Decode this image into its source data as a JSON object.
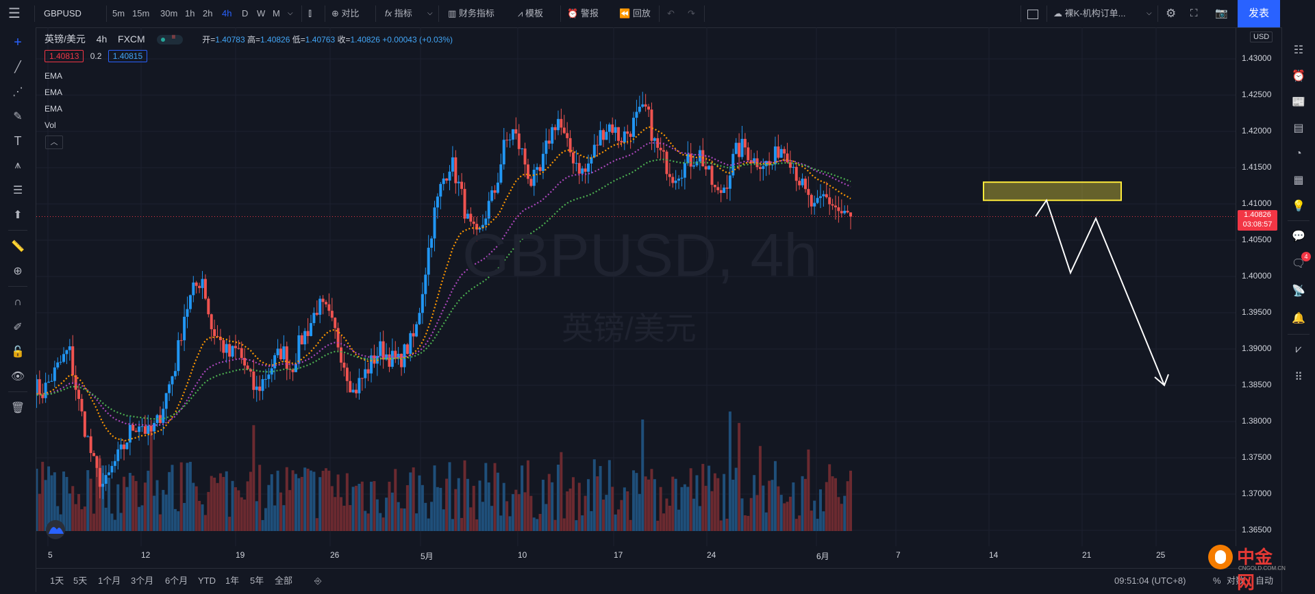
{
  "toolbar": {
    "menu_icon": "menu-icon",
    "symbol": "GBPUSD",
    "intervals": [
      "5m",
      "15m",
      "30m",
      "1h",
      "2h",
      "4h",
      "D",
      "W",
      "M"
    ],
    "active_interval": "4h",
    "compare": "对比",
    "indicators": "指标",
    "financials": "财务指标",
    "templates": "模板",
    "alerts": "警报",
    "replay": "回放",
    "layout_name": "裸K-机构订单...",
    "publish": "发表"
  },
  "legend": {
    "pair": "英镑/美元",
    "interval": "4h",
    "source": "FXCM",
    "open_label": "开=",
    "open": "1.40783",
    "high_label": "高=",
    "high": "1.40826",
    "low_label": "低=",
    "low": "1.40763",
    "close_label": "收=",
    "close": "1.40826",
    "change": "+0.00043 (+0.03%)",
    "bid": "1.40813",
    "spread": "0.2",
    "ask": "1.40815",
    "indicators": [
      "EMA",
      "EMA",
      "EMA",
      "Vol"
    ]
  },
  "watermark": {
    "main": "GBPUSD, 4h",
    "sub": "英镑/美元"
  },
  "price_axis": {
    "currency": "USD",
    "ticks": [
      "1.43000",
      "1.42500",
      "1.42000",
      "1.41500",
      "1.41000",
      "1.40500",
      "1.40000",
      "1.39500",
      "1.39000",
      "1.38500",
      "1.38000",
      "1.37500",
      "1.37000",
      "1.36500"
    ],
    "last_price": "1.40826",
    "countdown": "03:08:57"
  },
  "time_axis": [
    "5",
    "12",
    "19",
    "26",
    "5月",
    "10",
    "17",
    "24",
    "6月",
    "7",
    "14",
    "21",
    "25"
  ],
  "bottom": {
    "ranges": [
      "1天",
      "5天",
      "1个月",
      "3个月",
      "6个月",
      "YTD",
      "1年",
      "5年",
      "全部"
    ],
    "clock": "09:51:04 (UTC+8)",
    "options": [
      "%",
      "对数",
      "自动"
    ]
  },
  "brand": {
    "name": "中金网",
    "url": "CNGOLD.COM.CN"
  },
  "notifications_badge": "4",
  "colors": {
    "up": "#2196f3",
    "down": "#ef5350",
    "ema_fast": "#ff9800",
    "ema_mid": "#ab47bc",
    "ema_slow": "#4caf50",
    "zone": "#ffeb3b",
    "accent": "#2962ff",
    "current_price": "#f23645"
  },
  "chart_data": {
    "type": "candlestick",
    "symbol": "GBPUSD",
    "interval": "4h",
    "ylim": [
      1.363,
      1.433
    ],
    "x_labels": [
      "5",
      "12",
      "19",
      "26",
      "5月",
      "10",
      "17",
      "24",
      "6月",
      "7",
      "14",
      "21",
      "25"
    ],
    "path_close": [
      1.385,
      1.384,
      1.386,
      1.388,
      1.39,
      1.383,
      1.378,
      1.373,
      1.371,
      1.374,
      1.376,
      1.379,
      1.38,
      1.378,
      1.38,
      1.384,
      1.388,
      1.395,
      1.398,
      1.4,
      1.393,
      1.391,
      1.389,
      1.39,
      1.387,
      1.384,
      1.386,
      1.388,
      1.39,
      1.387,
      1.391,
      1.393,
      1.396,
      1.395,
      1.392,
      1.388,
      1.384,
      1.386,
      1.388,
      1.39,
      1.389,
      1.388,
      1.39,
      1.392,
      1.4,
      1.408,
      1.413,
      1.416,
      1.412,
      1.407,
      1.405,
      1.409,
      1.412,
      1.418,
      1.42,
      1.417,
      1.413,
      1.414,
      1.419,
      1.422,
      1.418,
      1.416,
      1.414,
      1.417,
      1.42,
      1.421,
      1.419,
      1.42,
      1.422,
      1.423,
      1.418,
      1.416,
      1.414,
      1.415,
      1.416,
      1.417,
      1.414,
      1.411,
      1.413,
      1.417,
      1.418,
      1.416,
      1.416,
      1.415,
      1.418,
      1.417,
      1.414,
      1.411,
      1.409,
      1.411,
      1.41,
      1.4085,
      1.4083
    ],
    "ema_fast_end": 1.4126,
    "ema_mid_end": 1.4124,
    "ema_slow_end": 1.4121,
    "resistance_zone": [
      1.4105,
      1.413
    ],
    "projection": [
      1.4083,
      1.4105,
      1.4005,
      1.408,
      1.385
    ],
    "last_close": 1.40826
  }
}
